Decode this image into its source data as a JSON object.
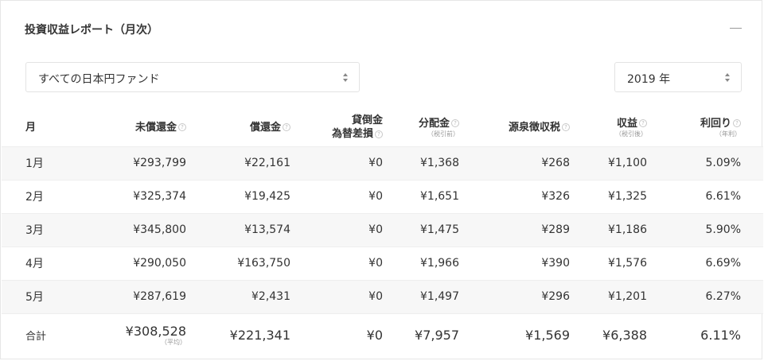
{
  "header": {
    "title": "投資収益レポート（月次）",
    "collapse_icon": "minus-icon"
  },
  "filters": {
    "fund": "すべての日本円ファンド",
    "year": "2019 年"
  },
  "columns": [
    {
      "label": "月"
    },
    {
      "label": "未償還金",
      "help": "?"
    },
    {
      "label": "償還金",
      "help": "?"
    },
    {
      "label_line1": "貸倒金",
      "label_line2": "為替差損",
      "help": "?"
    },
    {
      "label": "分配金",
      "help": "?",
      "sub": "（税引前）"
    },
    {
      "label": "源泉徴収税",
      "help": "?"
    },
    {
      "label": "収益",
      "help": "?",
      "sub": "（税引後）"
    },
    {
      "label": "利回り",
      "help": "?",
      "sub": "（年利）"
    }
  ],
  "rows": [
    {
      "month": "1月",
      "unredeemed": "¥293,799",
      "redeemed": "¥22,161",
      "loss": "¥0",
      "dividend": "¥1,368",
      "tax": "¥268",
      "profit": "¥1,100",
      "yield": "5.09%"
    },
    {
      "month": "2月",
      "unredeemed": "¥325,374",
      "redeemed": "¥19,425",
      "loss": "¥0",
      "dividend": "¥1,651",
      "tax": "¥326",
      "profit": "¥1,325",
      "yield": "6.61%"
    },
    {
      "month": "3月",
      "unredeemed": "¥345,800",
      "redeemed": "¥13,574",
      "loss": "¥0",
      "dividend": "¥1,475",
      "tax": "¥289",
      "profit": "¥1,186",
      "yield": "5.90%"
    },
    {
      "month": "4月",
      "unredeemed": "¥290,050",
      "redeemed": "¥163,750",
      "loss": "¥0",
      "dividend": "¥1,966",
      "tax": "¥390",
      "profit": "¥1,576",
      "yield": "6.69%"
    },
    {
      "month": "5月",
      "unredeemed": "¥287,619",
      "redeemed": "¥2,431",
      "loss": "¥0",
      "dividend": "¥1,497",
      "tax": "¥296",
      "profit": "¥1,201",
      "yield": "6.27%"
    }
  ],
  "total": {
    "label": "合計",
    "unredeemed": "¥308,528",
    "unredeemed_note": "（平均）",
    "redeemed": "¥221,341",
    "loss": "¥0",
    "dividend": "¥7,957",
    "tax": "¥1,569",
    "profit": "¥6,388",
    "yield": "6.11%"
  }
}
